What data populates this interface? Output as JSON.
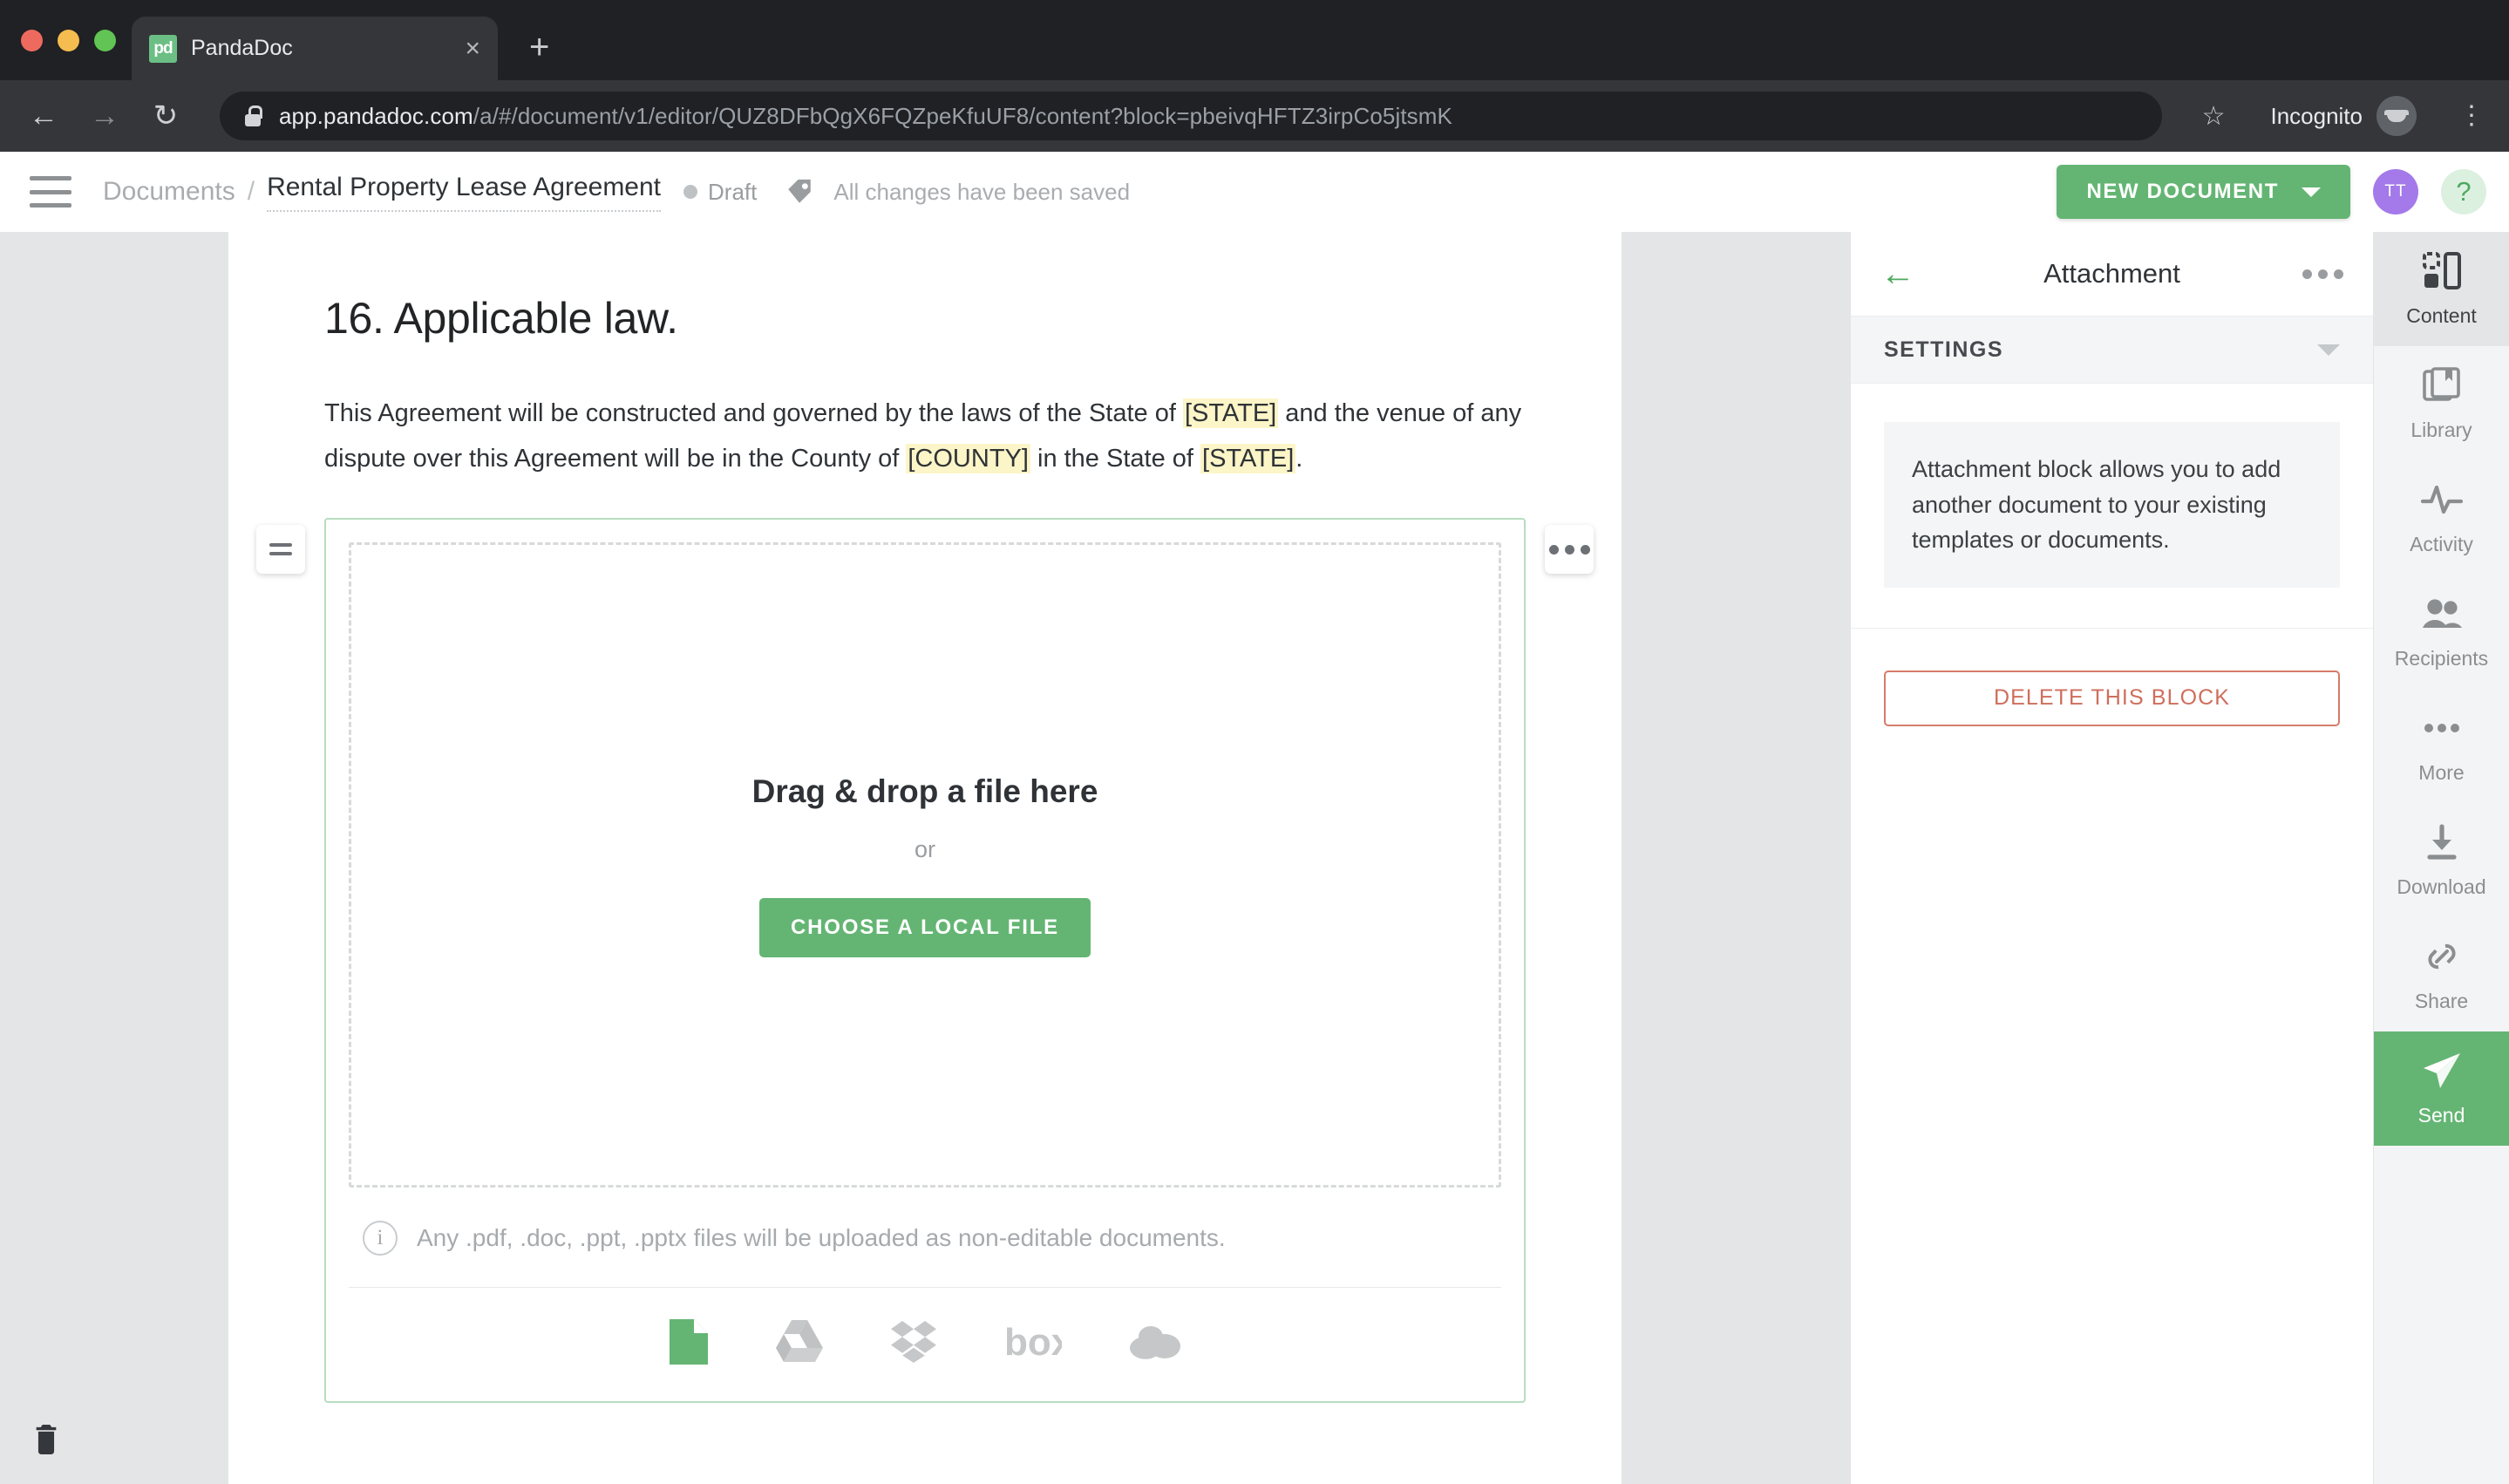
{
  "browser": {
    "tab": {
      "title": "PandaDoc",
      "favicon_text": "pd",
      "close_label": "×"
    },
    "new_tab_label": "+",
    "nav": {
      "back": "←",
      "forward": "→",
      "reload": "↻"
    },
    "url_secure": "app.pandadoc.com",
    "url_path": "/a/#/document/v1/editor/QUZ8DFbQgX6FQZpeKfuUF8/content?block=pbeivqHFTZ3irpCo5jtsmK",
    "bookmark_icon": "☆",
    "incognito_label": "Incognito",
    "menu_icon": "⋮"
  },
  "appbar": {
    "breadcrumb_root": "Documents",
    "breadcrumb_separator": "/",
    "document_title": "Rental Property Lease Agreement",
    "status": "Draft",
    "saved_message": "All changes have been saved",
    "new_document_label": "NEW DOCUMENT",
    "user_initials": "TT",
    "help_label": "?",
    "accent_green": "#64b573",
    "avatar_purple": "#a479ea"
  },
  "document": {
    "heading": "16. Applicable law.",
    "paragraph": {
      "part1": "This Agreement will be constructed and governed by the laws of the State of ",
      "token1": "[STATE]",
      "part2": " and the venue of any dispute over this Agreement will be in the County of ",
      "token2": "[COUNTY]",
      "part3": " in the State of ",
      "token3": "[STATE]",
      "part4": "."
    },
    "highlight_color": "#fcf5c7"
  },
  "attachment_block": {
    "drag_handle_name": "drag-handle",
    "more_handle_name": "block-more",
    "drop_title": "Drag & drop a file here",
    "drop_or": "or",
    "choose_button": "CHOOSE A LOCAL FILE",
    "note": "Any .pdf, .doc, .ppt, .pptx files will be uploaded as non-editable documents.",
    "services": [
      {
        "name": "local-file-icon",
        "label": "Local file"
      },
      {
        "name": "google-drive-icon",
        "label": "Google Drive"
      },
      {
        "name": "dropbox-icon",
        "label": "Dropbox"
      },
      {
        "name": "box-icon",
        "label": "Box"
      },
      {
        "name": "onedrive-icon",
        "label": "OneDrive"
      }
    ]
  },
  "side_panel": {
    "back_icon": "←",
    "title": "Attachment",
    "settings_label": "SETTINGS",
    "description": "Attachment block allows you to add another document to your existing templates or documents.",
    "delete_label": "DELETE THIS BLOCK",
    "delete_color": "#cf6e5c"
  },
  "rail": {
    "items": [
      {
        "label": "Content",
        "icon": "content-icon",
        "active": true
      },
      {
        "label": "Library",
        "icon": "library-icon",
        "active": false
      },
      {
        "label": "Activity",
        "icon": "activity-icon",
        "active": false
      },
      {
        "label": "Recipients",
        "icon": "recipients-icon",
        "active": false
      },
      {
        "label": "More",
        "icon": "more-icon",
        "active": false
      },
      {
        "label": "Download",
        "icon": "download-icon",
        "active": false
      },
      {
        "label": "Share",
        "icon": "share-icon",
        "active": false
      },
      {
        "label": "Send",
        "icon": "send-icon",
        "active": false
      }
    ]
  },
  "gutter": {
    "trash_icon": "trash-icon"
  }
}
